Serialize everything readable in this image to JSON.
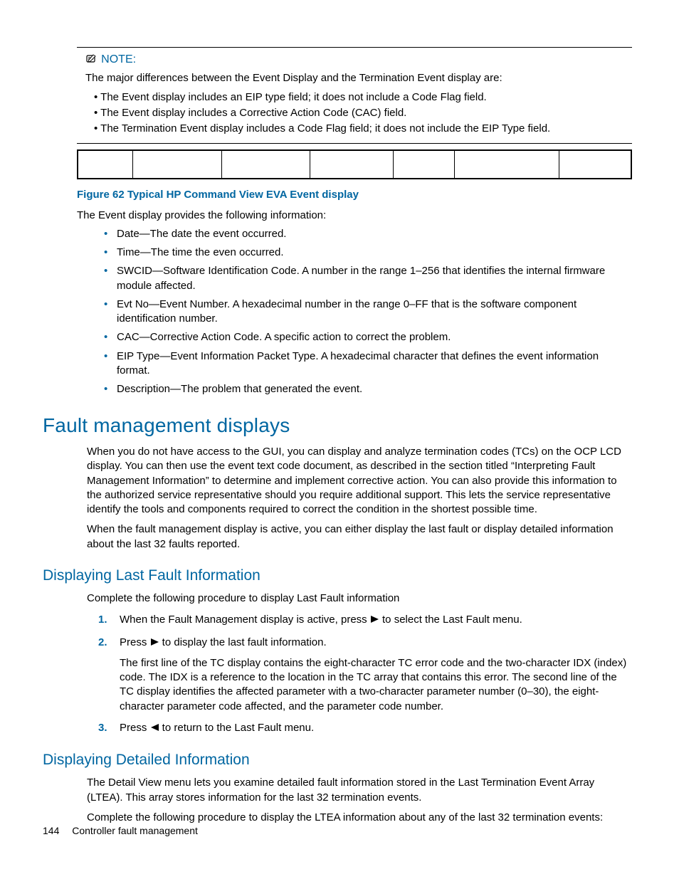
{
  "note": {
    "label": "NOTE:",
    "intro": "The major differences between the Event Display and the Termination Event display are:",
    "bullets": [
      "The Event display includes an EIP type field; it does not include a Code Flag field.",
      "The Event display includes a Corrective Action Code (CAC) field.",
      "The Termination Event display includes a Code Flag field; it does not include the EIP Type field."
    ]
  },
  "figure": {
    "caption": "Figure 62 Typical HP Command View EVA Event display",
    "cols": 7
  },
  "event_display": {
    "intro": "The Event display provides the following information:",
    "items": [
      "Date—The date the event occurred.",
      "Time—The time the even occurred.",
      "SWCID—Software Identification Code.  A number in the range 1–256 that identifies the internal firmware module affected.",
      "Evt No—Event Number.  A hexadecimal number in the range 0–FF that is the software component identification number.",
      "CAC—Corrective Action Code.  A specific action to correct the problem.",
      "EIP Type—Event Information Packet Type.  A hexadecimal character that defines the event information format.",
      "Description—The problem that generated the event."
    ]
  },
  "fmd": {
    "heading": "Fault management displays",
    "p1": "When you do not have access to the GUI, you can display and analyze termination codes (TCs) on the OCP LCD display.  You can then use the event text code document, as described in the section titled “Interpreting Fault Management Information” to determine and implement corrective action.  You can also provide this information to the authorized service representative should you require additional support.  This lets the service representative identify the tools and components required to correct the condition in the shortest possible time.",
    "p2": "When the fault management display is active, you can either display the last fault or display detailed information about the last 32 faults reported."
  },
  "last_fault": {
    "heading": "Displaying Last Fault Information",
    "intro": "Complete the following procedure to display Last Fault information",
    "step1_a": "When the Fault Management display is active, press ",
    "step1_b": " to select the Last Fault menu.",
    "step2_a": "Press ",
    "step2_b": " to display the last fault information.",
    "step2_detail": "The first line of the TC display contains the eight-character TC error code and the two-character IDX (index) code.  The IDX is a reference to the location in the TC array that contains this error.  The second line of the TC display identifies the affected parameter with a two-character parameter number (0–30), the eight-character parameter code affected, and the parameter code number.",
    "step3_a": "Press ",
    "step3_b": " to return to the Last Fault menu."
  },
  "detailed": {
    "heading": "Displaying Detailed Information",
    "p1": "The Detail View menu lets you examine detailed fault information stored in the Last Termination Event Array (LTEA). This array stores information for the last 32 termination events.",
    "p2": "Complete the following procedure to display the LTEA information about any of the last 32 termination events:"
  },
  "footer": {
    "page": "144",
    "title": "Controller fault management"
  }
}
